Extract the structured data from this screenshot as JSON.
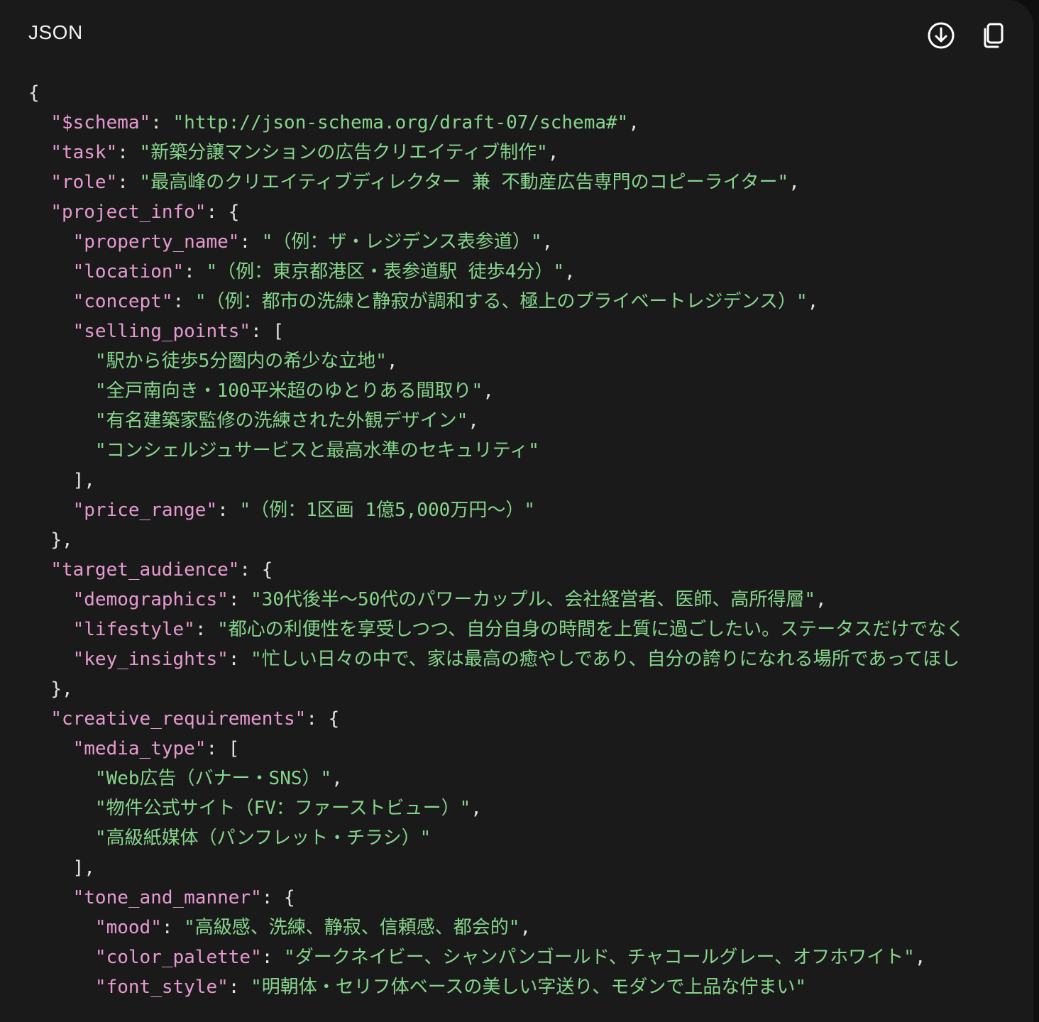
{
  "header": {
    "language_label": "JSON",
    "download_icon": "download-icon",
    "copy_icon": "copy-icon"
  },
  "colors": {
    "background": "#1a1a1a",
    "key": "#e79ad0",
    "string": "#86d58c",
    "punctuation": "#e2e2e2"
  },
  "code": {
    "lines": [
      {
        "indent": "",
        "tokens": [
          {
            "t": "p",
            "v": "{"
          }
        ]
      },
      {
        "indent": "  ",
        "tokens": [
          {
            "t": "k",
            "v": "\"$schema\""
          },
          {
            "t": "p",
            "v": ": "
          },
          {
            "t": "s",
            "v": "\"http://json-schema.org/draft-07/schema#\""
          },
          {
            "t": "p",
            "v": ","
          }
        ]
      },
      {
        "indent": "  ",
        "tokens": [
          {
            "t": "k",
            "v": "\"task\""
          },
          {
            "t": "p",
            "v": ": "
          },
          {
            "t": "s",
            "v": "\"新築分譲マンションの広告クリエイティブ制作\""
          },
          {
            "t": "p",
            "v": ","
          }
        ]
      },
      {
        "indent": "  ",
        "tokens": [
          {
            "t": "k",
            "v": "\"role\""
          },
          {
            "t": "p",
            "v": ": "
          },
          {
            "t": "s",
            "v": "\"最高峰のクリエイティブディレクター 兼 不動産広告専門のコピーライター\""
          },
          {
            "t": "p",
            "v": ","
          }
        ]
      },
      {
        "indent": "  ",
        "tokens": [
          {
            "t": "k",
            "v": "\"project_info\""
          },
          {
            "t": "p",
            "v": ": {"
          }
        ]
      },
      {
        "indent": "    ",
        "tokens": [
          {
            "t": "k",
            "v": "\"property_name\""
          },
          {
            "t": "p",
            "v": ": "
          },
          {
            "t": "s",
            "v": "\"（例：ザ・レジデンス表参道）\""
          },
          {
            "t": "p",
            "v": ","
          }
        ]
      },
      {
        "indent": "    ",
        "tokens": [
          {
            "t": "k",
            "v": "\"location\""
          },
          {
            "t": "p",
            "v": ": "
          },
          {
            "t": "s",
            "v": "\"（例：東京都港区・表参道駅 徒歩4分）\""
          },
          {
            "t": "p",
            "v": ","
          }
        ]
      },
      {
        "indent": "    ",
        "tokens": [
          {
            "t": "k",
            "v": "\"concept\""
          },
          {
            "t": "p",
            "v": ": "
          },
          {
            "t": "s",
            "v": "\"（例：都市の洗練と静寂が調和する、極上のプライベートレジデンス）\""
          },
          {
            "t": "p",
            "v": ","
          }
        ]
      },
      {
        "indent": "    ",
        "tokens": [
          {
            "t": "k",
            "v": "\"selling_points\""
          },
          {
            "t": "p",
            "v": ": ["
          }
        ]
      },
      {
        "indent": "      ",
        "tokens": [
          {
            "t": "s",
            "v": "\"駅から徒歩5分圏内の希少な立地\""
          },
          {
            "t": "p",
            "v": ","
          }
        ]
      },
      {
        "indent": "      ",
        "tokens": [
          {
            "t": "s",
            "v": "\"全戸南向き・100平米超のゆとりある間取り\""
          },
          {
            "t": "p",
            "v": ","
          }
        ]
      },
      {
        "indent": "      ",
        "tokens": [
          {
            "t": "s",
            "v": "\"有名建築家監修の洗練された外観デザイン\""
          },
          {
            "t": "p",
            "v": ","
          }
        ]
      },
      {
        "indent": "      ",
        "tokens": [
          {
            "t": "s",
            "v": "\"コンシェルジュサービスと最高水準のセキュリティ\""
          }
        ]
      },
      {
        "indent": "    ",
        "tokens": [
          {
            "t": "p",
            "v": "],"
          }
        ]
      },
      {
        "indent": "    ",
        "tokens": [
          {
            "t": "k",
            "v": "\"price_range\""
          },
          {
            "t": "p",
            "v": ": "
          },
          {
            "t": "s",
            "v": "\"（例：1区画 1億5,000万円～）\""
          }
        ]
      },
      {
        "indent": "  ",
        "tokens": [
          {
            "t": "p",
            "v": "},"
          }
        ]
      },
      {
        "indent": "  ",
        "tokens": [
          {
            "t": "k",
            "v": "\"target_audience\""
          },
          {
            "t": "p",
            "v": ": {"
          }
        ]
      },
      {
        "indent": "    ",
        "tokens": [
          {
            "t": "k",
            "v": "\"demographics\""
          },
          {
            "t": "p",
            "v": ": "
          },
          {
            "t": "s",
            "v": "\"30代後半～50代のパワーカップル、会社経営者、医師、高所得層\""
          },
          {
            "t": "p",
            "v": ","
          }
        ]
      },
      {
        "indent": "    ",
        "tokens": [
          {
            "t": "k",
            "v": "\"lifestyle\""
          },
          {
            "t": "p",
            "v": ": "
          },
          {
            "t": "s",
            "v": "\"都心の利便性を享受しつつ、自分自身の時間を上質に過ごしたい。ステータスだけでなく"
          }
        ]
      },
      {
        "indent": "    ",
        "tokens": [
          {
            "t": "k",
            "v": "\"key_insights\""
          },
          {
            "t": "p",
            "v": ": "
          },
          {
            "t": "s",
            "v": "\"忙しい日々の中で、家は最高の癒やしであり、自分の誇りになれる場所であってほし"
          }
        ]
      },
      {
        "indent": "  ",
        "tokens": [
          {
            "t": "p",
            "v": "},"
          }
        ]
      },
      {
        "indent": "  ",
        "tokens": [
          {
            "t": "k",
            "v": "\"creative_requirements\""
          },
          {
            "t": "p",
            "v": ": {"
          }
        ]
      },
      {
        "indent": "    ",
        "tokens": [
          {
            "t": "k",
            "v": "\"media_type\""
          },
          {
            "t": "p",
            "v": ": ["
          }
        ]
      },
      {
        "indent": "      ",
        "tokens": [
          {
            "t": "s",
            "v": "\"Web広告（バナー・SNS）\""
          },
          {
            "t": "p",
            "v": ","
          }
        ]
      },
      {
        "indent": "      ",
        "tokens": [
          {
            "t": "s",
            "v": "\"物件公式サイト（FV：ファーストビュー）\""
          },
          {
            "t": "p",
            "v": ","
          }
        ]
      },
      {
        "indent": "      ",
        "tokens": [
          {
            "t": "s",
            "v": "\"高級紙媒体（パンフレット・チラシ）\""
          }
        ]
      },
      {
        "indent": "    ",
        "tokens": [
          {
            "t": "p",
            "v": "],"
          }
        ]
      },
      {
        "indent": "    ",
        "tokens": [
          {
            "t": "k",
            "v": "\"tone_and_manner\""
          },
          {
            "t": "p",
            "v": ": {"
          }
        ]
      },
      {
        "indent": "      ",
        "tokens": [
          {
            "t": "k",
            "v": "\"mood\""
          },
          {
            "t": "p",
            "v": ": "
          },
          {
            "t": "s",
            "v": "\"高級感、洗練、静寂、信頼感、都会的\""
          },
          {
            "t": "p",
            "v": ","
          }
        ]
      },
      {
        "indent": "      ",
        "tokens": [
          {
            "t": "k",
            "v": "\"color_palette\""
          },
          {
            "t": "p",
            "v": ": "
          },
          {
            "t": "s",
            "v": "\"ダークネイビー、シャンパンゴールド、チャコールグレー、オフホワイト\""
          },
          {
            "t": "p",
            "v": ","
          }
        ]
      },
      {
        "indent": "      ",
        "tokens": [
          {
            "t": "k",
            "v": "\"font_style\""
          },
          {
            "t": "p",
            "v": ": "
          },
          {
            "t": "s",
            "v": "\"明朝体・セリフ体ベースの美しい字送り、モダンで上品な佇まい\""
          }
        ]
      }
    ]
  }
}
